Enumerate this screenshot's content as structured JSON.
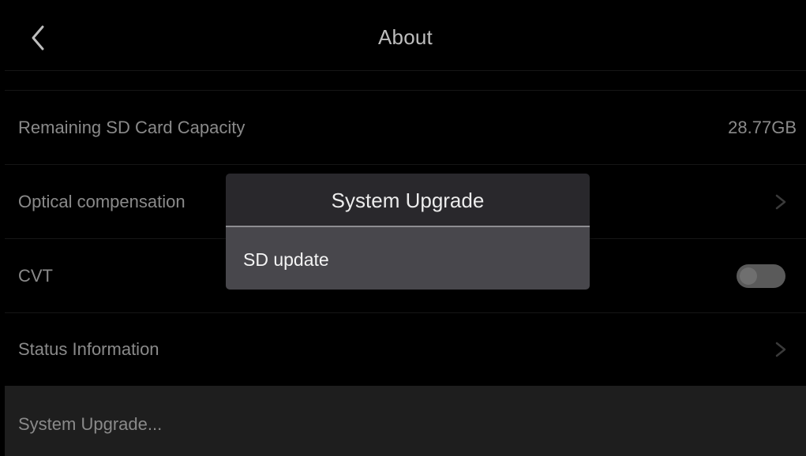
{
  "header": {
    "title": "About",
    "back_icon": "chevron-left-icon"
  },
  "settings": {
    "sd_capacity": {
      "label": "Remaining SD Card Capacity",
      "value": "28.77GB"
    },
    "optical_compensation": {
      "label": "Optical compensation",
      "icon": "chevron-right-icon"
    },
    "cvt": {
      "label": "CVT",
      "toggle_on": false
    },
    "status_information": {
      "label": "Status Information",
      "icon": "chevron-right-icon"
    },
    "system_upgrade": {
      "label": "System Upgrade..."
    }
  },
  "dialog": {
    "title": "System Upgrade",
    "options": [
      {
        "label": "SD update"
      }
    ]
  },
  "colors": {
    "background": "#000000",
    "dialog_header": "#29282c",
    "dialog_option": "#48474c",
    "highlight_row": "#1e1e1e"
  }
}
